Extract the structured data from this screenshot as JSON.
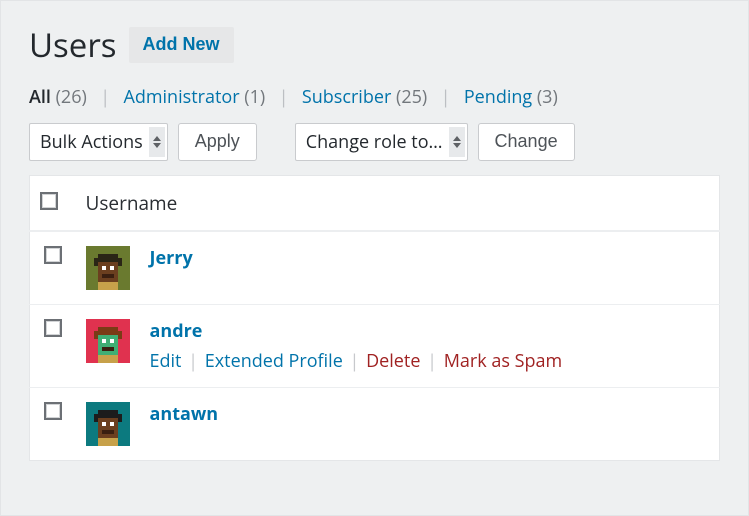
{
  "header": {
    "title": "Users",
    "add_new": "Add New"
  },
  "filters": {
    "all_label": "All",
    "all_count": "(26)",
    "admin_label": "Administrator",
    "admin_count": "(1)",
    "subscriber_label": "Subscriber",
    "subscriber_count": "(25)",
    "pending_label": "Pending",
    "pending_count": "(3)"
  },
  "toolbar": {
    "bulk_actions": "Bulk Actions",
    "apply": "Apply",
    "change_role": "Change role to…",
    "change": "Change"
  },
  "table": {
    "col_username": "Username"
  },
  "rows": [
    {
      "username": "Jerry",
      "avatar_bg": "#6a7a2f",
      "skin": "#6b3f1f",
      "hair": "#2a2516",
      "show_actions": false
    },
    {
      "username": "andre",
      "avatar_bg": "#e0324f",
      "skin": "#3fae74",
      "hair": "#7a3b16",
      "show_actions": true
    },
    {
      "username": "antawn",
      "avatar_bg": "#0c7a7f",
      "skin": "#6b3f1f",
      "hair": "#1c1c1c",
      "show_actions": false
    }
  ],
  "actions": {
    "edit": "Edit",
    "extended": "Extended Profile",
    "delete": "Delete",
    "spam": "Mark as Spam"
  }
}
